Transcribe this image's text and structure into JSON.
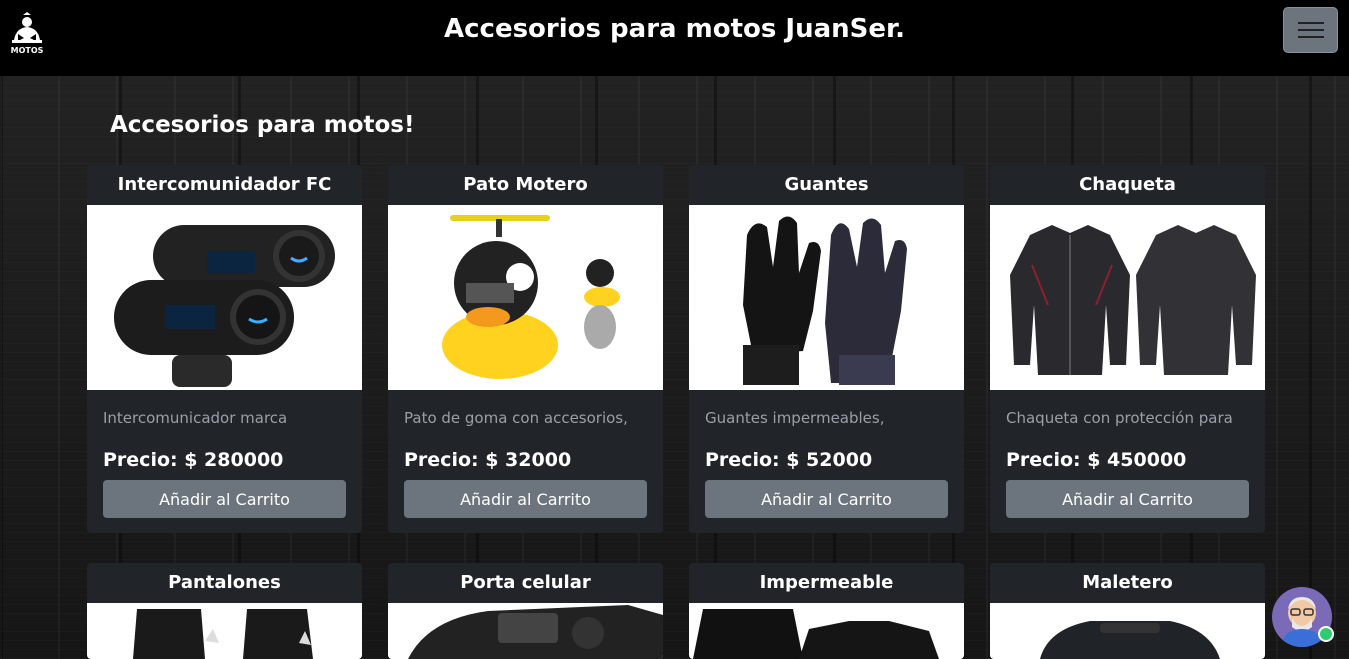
{
  "navbar": {
    "logo_text": "MOTOS",
    "title": "Accesorios para motos JuanSer.",
    "menu_icon": "hamburger-menu-icon"
  },
  "section": {
    "title": "Accesorios para motos!"
  },
  "products": [
    {
      "name": "Intercomunidador FC",
      "description": "Intercomunicador marca",
      "price": "Precio: $ 280000",
      "button": "Añadir al Carrito",
      "image": "intercom-image"
    },
    {
      "name": "Pato Motero",
      "description": "Pato de goma con accesorios,",
      "price": "Precio: $ 32000",
      "button": "Añadir al Carrito",
      "image": "rubber-duck-image"
    },
    {
      "name": "Guantes",
      "description": "Guantes impermeables,",
      "price": "Precio: $ 52000",
      "button": "Añadir al Carrito",
      "image": "gloves-image"
    },
    {
      "name": "Chaqueta",
      "description": "Chaqueta con protección para",
      "price": "Precio: $ 450000",
      "button": "Añadir al Carrito",
      "image": "jacket-image"
    },
    {
      "name": "Pantalones",
      "image": "pants-image"
    },
    {
      "name": "Porta celular",
      "image": "phone-holder-image"
    },
    {
      "name": "Impermeable",
      "image": "raincoat-image"
    },
    {
      "name": "Maletero",
      "image": "top-case-image"
    }
  ],
  "chat_widget": {
    "icon": "support-avatar-icon",
    "status_color": "#2ecc71"
  },
  "colors": {
    "navbar": "#000000",
    "card": "#212529",
    "button": "#6c757d"
  }
}
